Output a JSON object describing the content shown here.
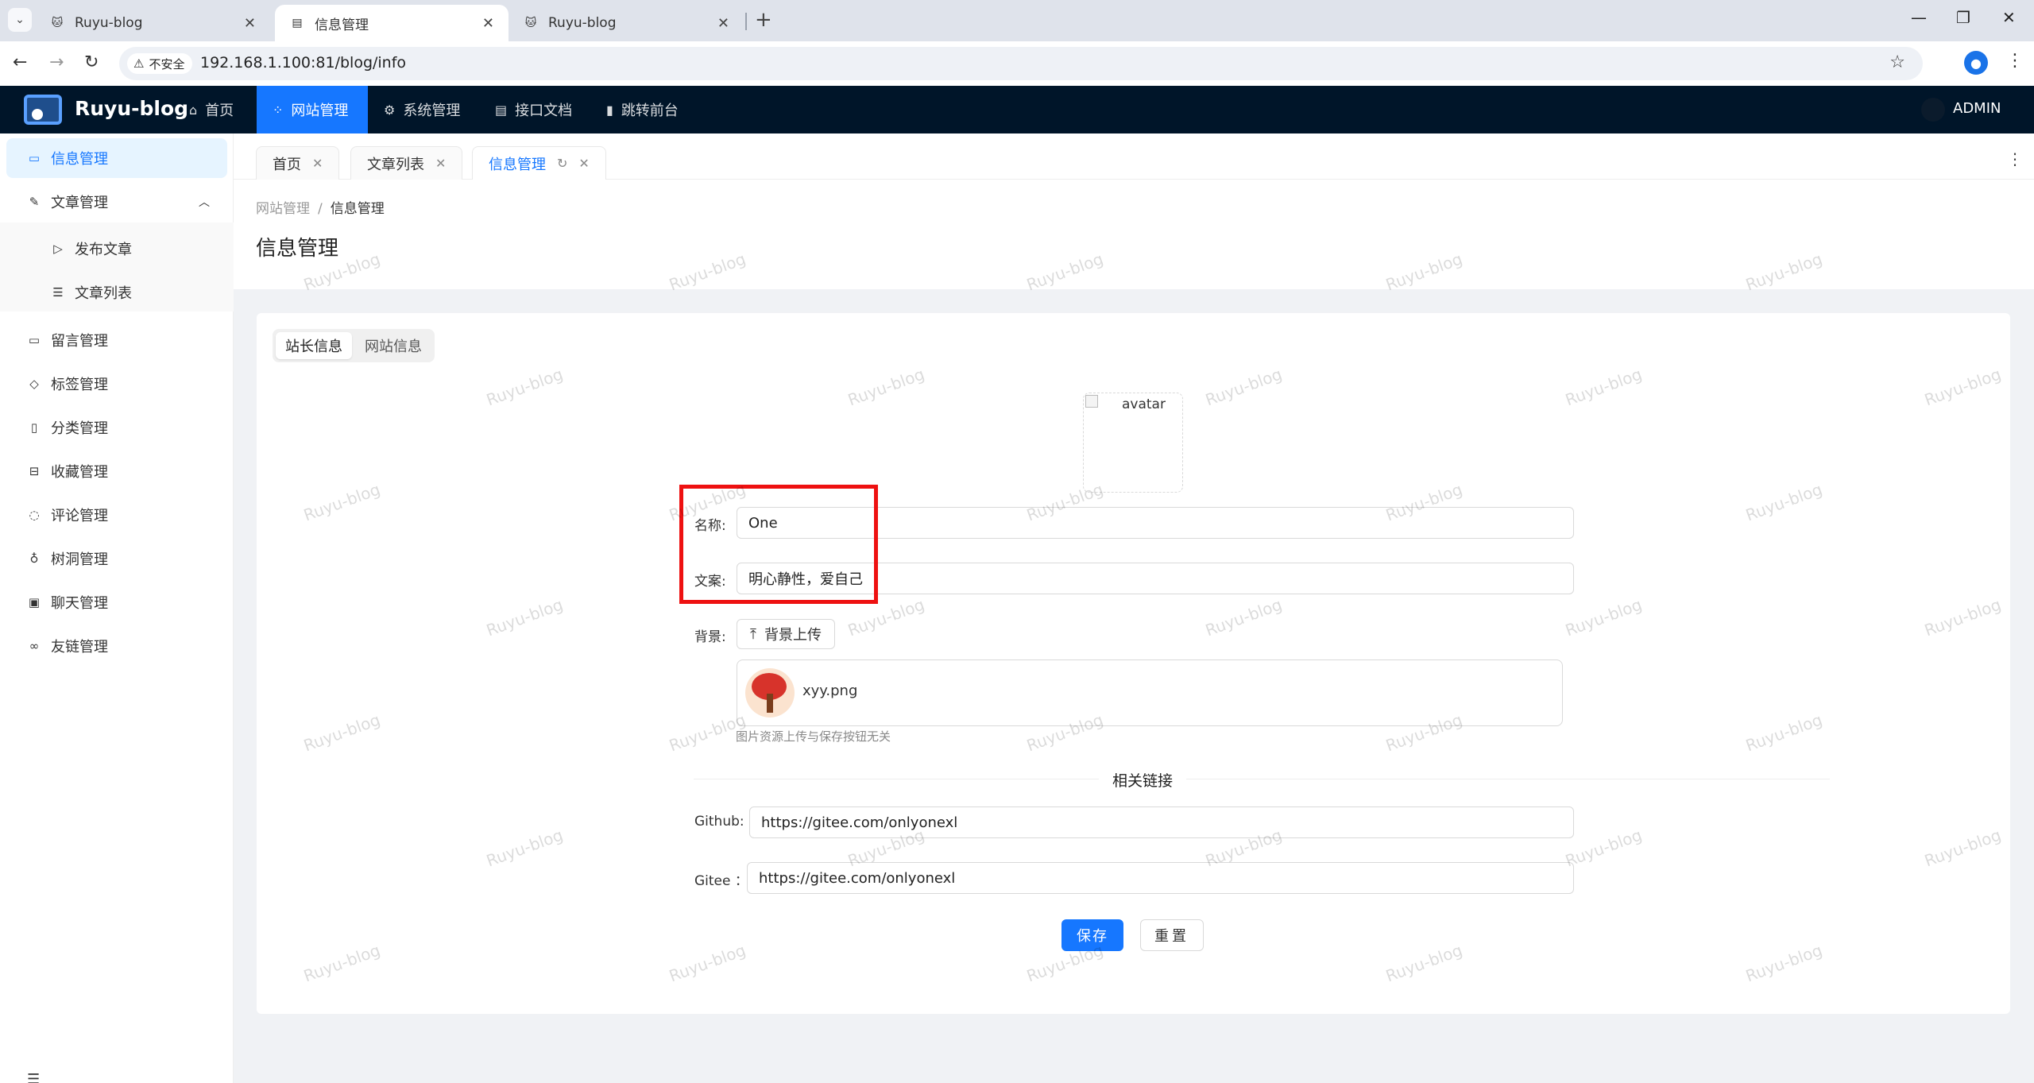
{
  "browser": {
    "tabs": [
      {
        "title": "Ruyu-blog",
        "active": false
      },
      {
        "title": "信息管理",
        "active": true
      },
      {
        "title": "Ruyu-blog",
        "active": false
      }
    ],
    "insecure_label": "不安全",
    "url": "192.168.1.100:81/blog/info"
  },
  "header": {
    "logo_text": "Ruyu-blog",
    "nav": [
      {
        "label": "首页",
        "icon": "home-icon",
        "active": false
      },
      {
        "label": "网站管理",
        "icon": "apps-icon",
        "active": true
      },
      {
        "label": "系统管理",
        "icon": "gear-icon",
        "active": false
      },
      {
        "label": "接口文档",
        "icon": "document-icon",
        "active": false
      },
      {
        "label": "跳转前台",
        "icon": "book-icon",
        "active": false
      }
    ],
    "user": "ADMIN"
  },
  "sidebar": {
    "items": [
      {
        "label": "信息管理",
        "icon": "info-icon",
        "active": true
      },
      {
        "label": "文章管理",
        "icon": "edit-icon",
        "expanded": true
      },
      {
        "label": "发布文章",
        "icon": "send-icon"
      },
      {
        "label": "文章列表",
        "icon": "list-icon"
      },
      {
        "label": "留言管理",
        "icon": "message-icon"
      },
      {
        "label": "标签管理",
        "icon": "tag-icon"
      },
      {
        "label": "分类管理",
        "icon": "category-icon"
      },
      {
        "label": "收藏管理",
        "icon": "lock-icon"
      },
      {
        "label": "评论管理",
        "icon": "comment-icon"
      },
      {
        "label": "树洞管理",
        "icon": "bulb-icon"
      },
      {
        "label": "聊天管理",
        "icon": "chat-icon"
      },
      {
        "label": "友链管理",
        "icon": "link-icon"
      }
    ]
  },
  "page_tabs": [
    {
      "label": "首页",
      "active": false
    },
    {
      "label": "文章列表",
      "active": false
    },
    {
      "label": "信息管理",
      "active": true
    }
  ],
  "breadcrumb": {
    "parent": "网站管理",
    "current": "信息管理"
  },
  "page_title": "信息管理",
  "segmented": {
    "options": [
      "站长信息",
      "网站信息"
    ],
    "selected": "站长信息"
  },
  "form": {
    "avatar_alt": "avatar",
    "name_label": "名称:",
    "name_value": "One",
    "motto_label": "文案:",
    "motto_value": "明心静性，爱自己",
    "bg_label": "背景:",
    "upload_label": "背景上传",
    "file_name": "xyy.png",
    "upload_hint": "图片资源上传与保存按钮无关",
    "links_title": "相关链接",
    "github_label": "Github:",
    "github_value": "https://gitee.com/onlyonexl",
    "gitee_label": "Gitee ：",
    "gitee_value": "https://gitee.com/onlyonexl",
    "save_label": "保存",
    "reset_label": "重置"
  },
  "watermark": "Ruyu-blog",
  "colors": {
    "primary": "#1677ff",
    "header_bg": "#001529",
    "highlight": "#ee1111"
  }
}
